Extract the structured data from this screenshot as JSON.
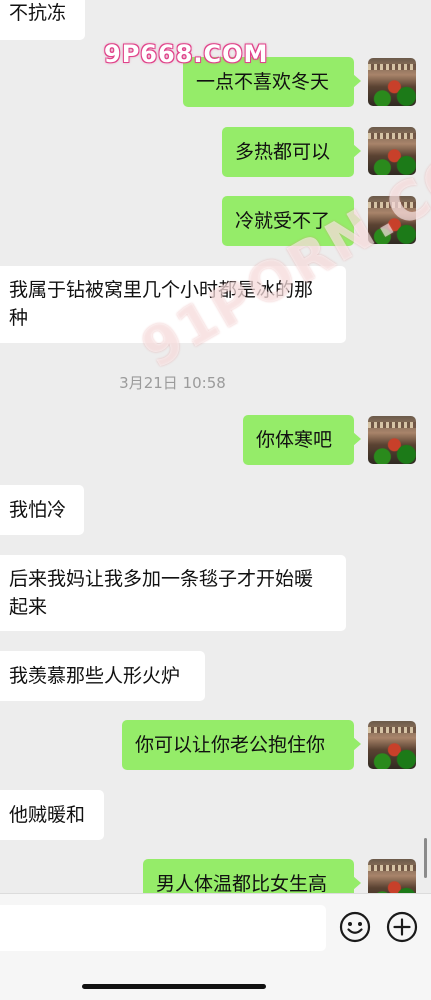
{
  "messages": [
    {
      "side": "in",
      "text": "不抗冻"
    },
    {
      "side": "out",
      "text": "一点不喜欢冬天"
    },
    {
      "side": "out",
      "text": "多热都可以"
    },
    {
      "side": "out",
      "text": "冷就受不了"
    },
    {
      "side": "in",
      "line1": "我属于钻被窝里几个小时都是冰的那",
      "line2": "种"
    },
    {
      "side": "out",
      "text": "你体寒吧"
    },
    {
      "side": "in",
      "text": "我怕冷"
    },
    {
      "side": "in",
      "line1": "后来我妈让我多加一条毯子才开始暖",
      "line2": "起来"
    },
    {
      "side": "in",
      "text": "我羡慕那些人形火炉"
    },
    {
      "side": "out",
      "text": "你可以让你老公抱住你"
    },
    {
      "side": "in",
      "text": "他贼暖和"
    },
    {
      "side": "out",
      "text": "男人体温都比女生高"
    }
  ],
  "timestamp": "3月21日 10:58",
  "watermarks": {
    "top": "9P668.COM",
    "diagonal": "91PORN.COM"
  },
  "input": {
    "value": "",
    "placeholder": ""
  },
  "icons": {
    "emoji": "emoji-icon",
    "plus": "plus-icon"
  },
  "colors": {
    "background": "#ededed",
    "outgoing_bubble": "#95ec69",
    "incoming_bubble": "#ffffff"
  }
}
